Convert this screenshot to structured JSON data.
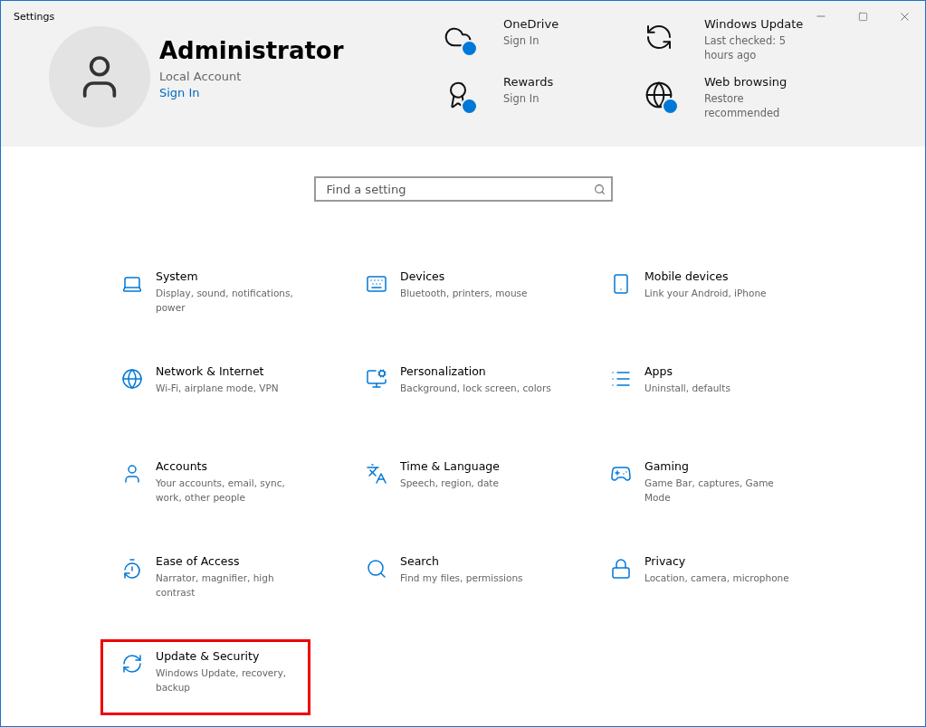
{
  "window": {
    "title": "Settings"
  },
  "account": {
    "name": "Administrator",
    "type": "Local Account",
    "link": "Sign In"
  },
  "status_items": [
    {
      "title": "OneDrive",
      "detail": "Sign In",
      "badge": true
    },
    {
      "title": "Windows Update",
      "detail": "Last checked: 5 hours ago",
      "badge": false
    },
    {
      "title": "Rewards",
      "detail": "Sign In",
      "badge": true
    },
    {
      "title": "Web browsing",
      "detail": "Restore recommended",
      "badge": true
    }
  ],
  "search": {
    "placeholder": "Find a setting"
  },
  "categories": [
    {
      "title": "System",
      "detail": "Display, sound, notifications, power",
      "highlighted": false
    },
    {
      "title": "Devices",
      "detail": "Bluetooth, printers, mouse",
      "highlighted": false
    },
    {
      "title": "Mobile devices",
      "detail": "Link your Android, iPhone",
      "highlighted": false
    },
    {
      "title": "Network & Internet",
      "detail": "Wi-Fi, airplane mode, VPN",
      "highlighted": false
    },
    {
      "title": "Personalization",
      "detail": "Background, lock screen, colors",
      "highlighted": false
    },
    {
      "title": "Apps",
      "detail": "Uninstall, defaults",
      "highlighted": false
    },
    {
      "title": "Accounts",
      "detail": "Your accounts, email, sync, work, other people",
      "highlighted": false
    },
    {
      "title": "Time & Language",
      "detail": "Speech, region, date",
      "highlighted": false
    },
    {
      "title": "Gaming",
      "detail": "Game Bar, captures, Game Mode",
      "highlighted": false
    },
    {
      "title": "Ease of Access",
      "detail": "Narrator, magnifier, high contrast",
      "highlighted": false
    },
    {
      "title": "Search",
      "detail": "Find my files, permissions",
      "highlighted": false
    },
    {
      "title": "Privacy",
      "detail": "Location, camera, microphone",
      "highlighted": false
    },
    {
      "title": "Update & Security",
      "detail": "Windows Update, recovery, backup",
      "highlighted": true
    }
  ]
}
